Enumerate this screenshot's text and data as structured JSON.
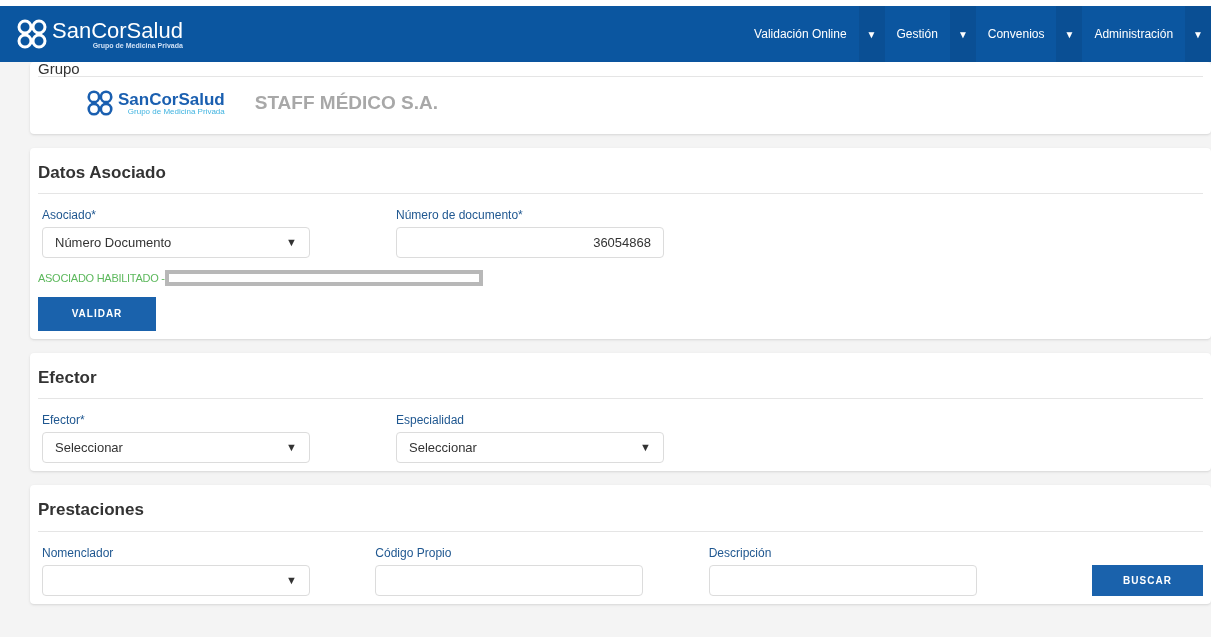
{
  "header": {
    "logo": {
      "name": "SanCorSalud",
      "tagline": "Grupo de Medicina Privada"
    },
    "menu": [
      {
        "label": "Validación Online",
        "caret": "▼"
      },
      {
        "label": "Gestión",
        "caret": "▼"
      },
      {
        "label": "Convenios",
        "caret": "▼"
      },
      {
        "label": "Administración",
        "caret": "▼"
      }
    ]
  },
  "grupo": {
    "title": "Grupo",
    "logo": {
      "name": "SanCorSalud",
      "tagline": "Grupo de Medicina Privada"
    },
    "company": "STAFF MÉDICO S.A."
  },
  "sections": [
    {
      "title": "Datos Asociado",
      "fields": [
        {
          "kind": "select",
          "label": "Asociado*",
          "value": "Número Documento",
          "caret": "▼"
        },
        {
          "kind": "input",
          "label": "Número de documento*",
          "value": "36054868"
        }
      ],
      "status": "ASOCIADO HABILITADO -",
      "button": "VALIDAR"
    },
    {
      "title": "Efector",
      "fields": [
        {
          "kind": "select",
          "label": "Efector*",
          "value": "Seleccionar",
          "caret": "▼"
        },
        {
          "kind": "select",
          "label": "Especialidad",
          "value": "Seleccionar",
          "caret": "▼"
        }
      ]
    },
    {
      "title": "Prestaciones",
      "fields": [
        {
          "kind": "select",
          "label": "Nomenclador",
          "caret": "▼"
        },
        {
          "kind": "input",
          "label": "Código Propio"
        },
        {
          "kind": "input",
          "label": "Descripción"
        }
      ],
      "button": "BUSCAR"
    }
  ]
}
